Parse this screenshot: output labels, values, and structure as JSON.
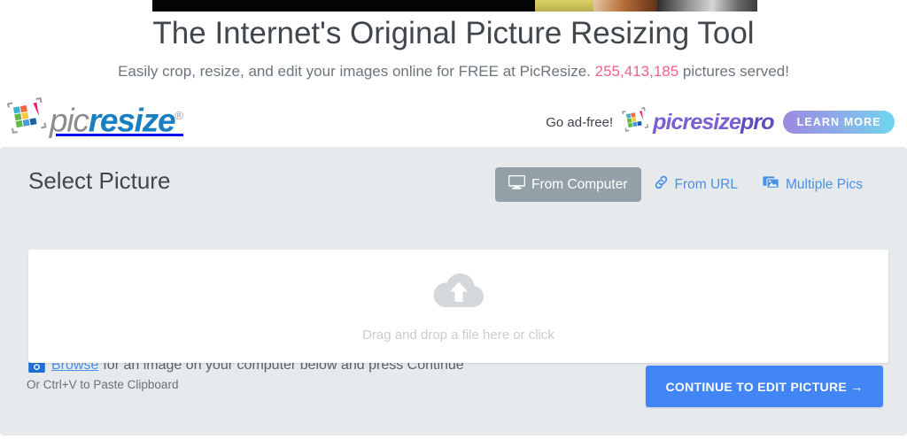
{
  "hero": {
    "title": "The Internet's Original Picture Resizing Tool",
    "subtitle_before": "Easily crop, resize, and edit your images online for FREE at PicResize.",
    "counter": "255,413,185",
    "subtitle_after": "pictures served!",
    "counter_color": "#f0628c"
  },
  "brand": {
    "icon": "picresize-grid-icon",
    "name_first": "pic",
    "name_second": "resize",
    "registered_mark": "®",
    "color_first": "#8c8c8c",
    "color_second": "#1a7ec2"
  },
  "promo": {
    "label": "Go ad-free!",
    "icon": "picresize-pro-grid-icon",
    "brand_first": "picresize",
    "brand_second": "pro",
    "cta_label": "LEARN MORE",
    "chevron": "»",
    "brand_color": "#5f4bbd"
  },
  "panel": {
    "title": "Select Picture",
    "browse_icon": "camera-icon",
    "browse_link": "Browse",
    "browse_text": "for an image on your computer below and press Continue",
    "tabs": [
      {
        "label": "From Computer",
        "icon": "desktop-icon",
        "active": true
      },
      {
        "label": "From URL",
        "icon": "link-icon",
        "active": false
      },
      {
        "label": "Multiple Pics",
        "icon": "images-icon",
        "active": false
      }
    ],
    "dropzone": {
      "icon": "cloud-upload-icon",
      "text": "Drag and drop a file here or click"
    },
    "paste_hint": "Or Ctrl+V to Paste Clipboard",
    "continue_label": "CONTINUE TO EDIT PICTURE →",
    "continue_color": "#4285f4",
    "panel_bg": "#e6eaed"
  }
}
